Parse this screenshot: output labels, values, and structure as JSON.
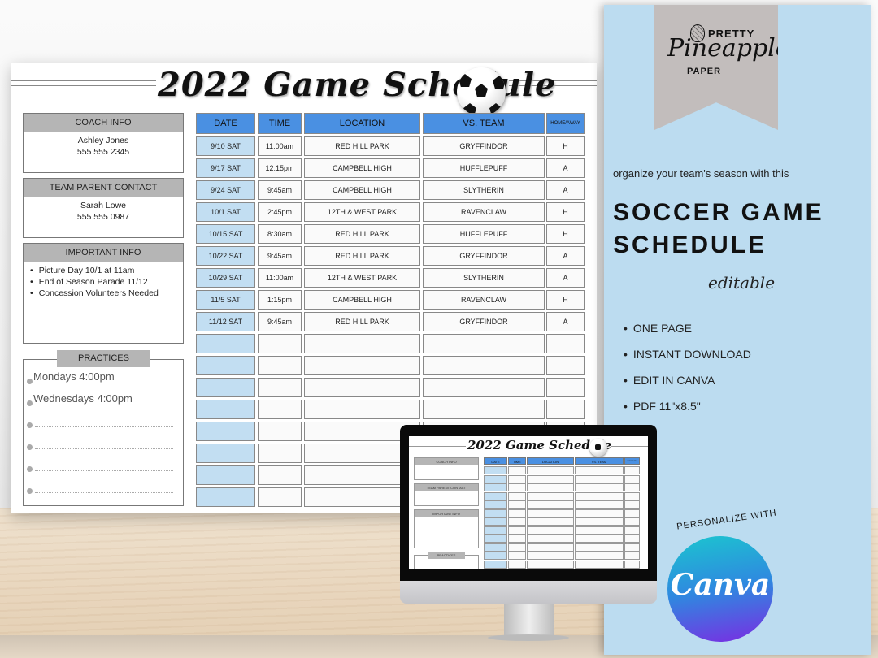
{
  "schedule": {
    "title": "2022 Game Schedule",
    "coach_info": {
      "label": "COACH INFO",
      "name": "Ashley Jones",
      "phone": "555 555 2345"
    },
    "team_parent": {
      "label": "TEAM PARENT CONTACT",
      "name": "Sarah Lowe",
      "phone": "555 555 0987"
    },
    "important_info": {
      "label": "IMPORTANT INFO",
      "items": [
        "Picture Day 10/1 at 11am",
        "End of Season Parade 11/12",
        "Concession Volunteers Needed"
      ]
    },
    "practices": {
      "label": "PRACTICES",
      "items": [
        "Mondays 4:00pm",
        "Wednesdays 4:00pm",
        "",
        "",
        "",
        ""
      ]
    },
    "table": {
      "headers": [
        "DATE",
        "TIME",
        "LOCATION",
        "VS. TEAM",
        "HOME/AWAY"
      ],
      "rows": [
        [
          "9/10 SAT",
          "11:00am",
          "RED HILL PARK",
          "GRYFFINDOR",
          "H"
        ],
        [
          "9/17 SAT",
          "12:15pm",
          "CAMPBELL HIGH",
          "HUFFLEPUFF",
          "A"
        ],
        [
          "9/24 SAT",
          "9:45am",
          "CAMPBELL HIGH",
          "SLYTHERIN",
          "A"
        ],
        [
          "10/1 SAT",
          "2:45pm",
          "12TH & WEST PARK",
          "RAVENCLAW",
          "H"
        ],
        [
          "10/15 SAT",
          "8:30am",
          "RED HILL PARK",
          "HUFFLEPUFF",
          "H"
        ],
        [
          "10/22 SAT",
          "9:45am",
          "RED HILL PARK",
          "GRYFFINDOR",
          "A"
        ],
        [
          "10/29 SAT",
          "11:00am",
          "12TH & WEST PARK",
          "SLYTHERIN",
          "A"
        ],
        [
          "11/5 SAT",
          "1:15pm",
          "CAMPBELL HIGH",
          "RAVENCLAW",
          "H"
        ],
        [
          "11/12 SAT",
          "9:45am",
          "RED HILL PARK",
          "GRYFFINDOR",
          "A"
        ],
        [
          "",
          "",
          "",
          "",
          ""
        ],
        [
          "",
          "",
          "",
          "",
          ""
        ],
        [
          "",
          "",
          "",
          "",
          ""
        ],
        [
          "",
          "",
          "",
          "",
          ""
        ],
        [
          "",
          "",
          "",
          "",
          ""
        ],
        [
          "",
          "",
          "",
          "",
          ""
        ],
        [
          "",
          "",
          "",
          "",
          ""
        ],
        [
          "",
          "",
          "",
          "",
          ""
        ]
      ]
    }
  },
  "panel": {
    "brand": {
      "line1": "PRETTY",
      "line2": "Pineapple",
      "line3": "PAPER"
    },
    "tagline": "organize your team's season with this",
    "headline_line1": "SOCCER GAME",
    "headline_line2": "SCHEDULE",
    "subtitle": "editable",
    "features": [
      "ONE PAGE",
      "INSTANT DOWNLOAD",
      "EDIT IN CANVA",
      "PDF 11\"x8.5\""
    ],
    "canva_badge": {
      "arc_text": "PERSONALIZE WITH",
      "logo_text": "Canva"
    },
    "colors": {
      "panel_bg": "#bcdcf0",
      "header_blue": "#4a90e2",
      "date_cell": "#c2def2",
      "label_gray": "#b5b5b5"
    }
  },
  "monitor": {
    "title": "2022 Game Schedule",
    "labels": [
      "COACH INFO",
      "TEAM PARENT CONTACT",
      "IMPORTANT INFO",
      "PRACTICES"
    ],
    "headers": [
      "DATE",
      "TIME",
      "LOCATION",
      "VS. TEAM",
      "HOME/AWAY"
    ]
  }
}
